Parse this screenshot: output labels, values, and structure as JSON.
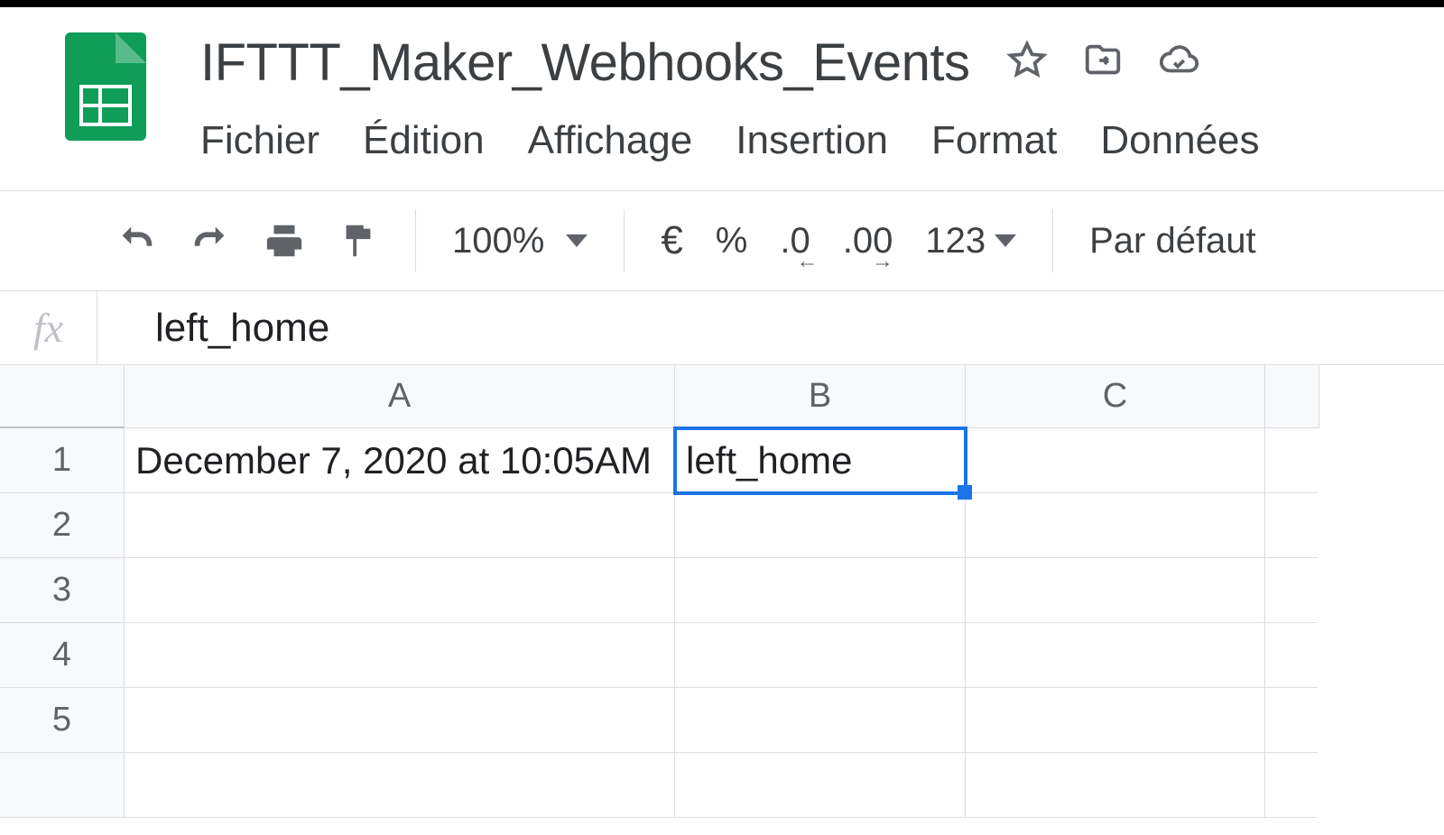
{
  "document": {
    "title": "IFTTT_Maker_Webhooks_Events"
  },
  "menubar": {
    "file": "Fichier",
    "edit": "Édition",
    "view": "Affichage",
    "insert": "Insertion",
    "format": "Format",
    "data": "Données"
  },
  "toolbar": {
    "zoom": "100%",
    "currency": "€",
    "percent": "%",
    "dec_less": ".0",
    "dec_more": ".00",
    "num_format": "123",
    "font": "Par défaut"
  },
  "formula_bar": {
    "label": "fx",
    "value": "left_home"
  },
  "columns": [
    "A",
    "B",
    "C"
  ],
  "row_numbers": [
    "1",
    "2",
    "3",
    "4",
    "5"
  ],
  "cells": {
    "A1": "December 7, 2020 at 10:05AM",
    "B1": "left_home"
  },
  "selection": "B1"
}
